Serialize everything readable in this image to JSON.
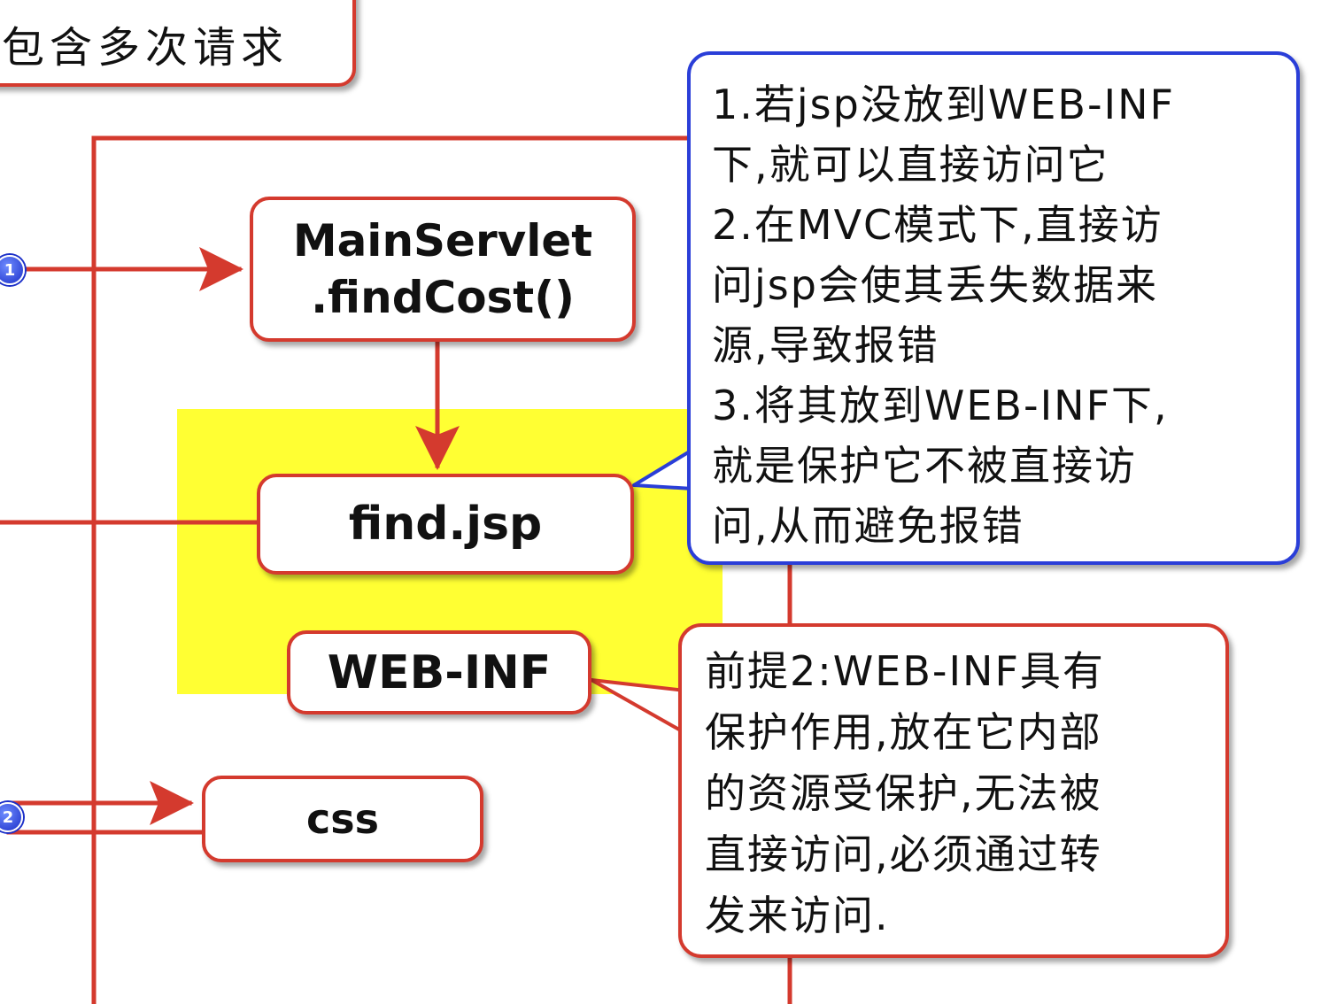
{
  "top_note": {
    "text": "包含多次请求"
  },
  "nodes": {
    "main_servlet": {
      "line1": "MainServlet",
      "line2": ".findCost()"
    },
    "find_jsp": "find.jsp",
    "web_inf": "WEB-INF",
    "css": "css"
  },
  "badges": {
    "one": "1",
    "two": "2"
  },
  "callout_blue": {
    "text": "1.若jsp没放到WEB-INF\n下,就可以直接访问它\n2.在MVC模式下,直接访\n问jsp会使其丢失数据来\n源,导致报错\n3.将其放到WEB-INF下,\n就是保护它不被直接访\n问,从而避免报错"
  },
  "callout_red": {
    "text": "前提2:WEB-INF具有\n保护作用,放在它内部\n的资源受保护,无法被\n直接访问,必须通过转\n发来访问."
  },
  "colors": {
    "arrow_red": "#d43a2e",
    "callout_blue_border": "#2a3ed8",
    "highlight_yellow": "#ffff33",
    "badge_blue": "#1b2fc8"
  }
}
